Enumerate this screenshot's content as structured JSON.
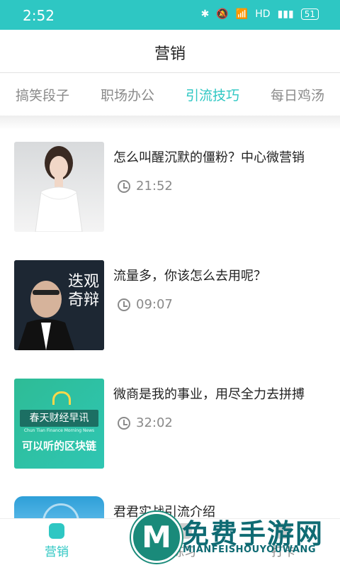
{
  "status": {
    "time": "2:52",
    "network": "HD",
    "battery": "51"
  },
  "header": {
    "title": "营销"
  },
  "tabs": [
    {
      "label": "搞笑段子"
    },
    {
      "label": "职场办公"
    },
    {
      "label": "引流技巧",
      "active": true
    },
    {
      "label": "每日鸡汤"
    }
  ],
  "items": [
    {
      "title": "怎么叫醒沉默的僵粉？中心微营销",
      "duration": "21:52"
    },
    {
      "title": "流量多，你该怎么去用呢？",
      "duration": "09:07",
      "thumb_text": "迭观奇辩"
    },
    {
      "title": "微商是我的事业，用尽全力去拼搏",
      "duration": "32:02",
      "thumb_text": {
        "line1": "春天财经早讯",
        "line2": "Chun Tian Finance Morning News",
        "line3": "可以听的区块链"
      }
    },
    {
      "title": "君君实战引流介绍"
    }
  ],
  "bottom_nav": [
    {
      "label": "营销",
      "active": true
    },
    {
      "label": "练习"
    },
    {
      "label": "打卡"
    }
  ],
  "watermark": {
    "text": "免费手游网",
    "sub": "MIANFEISHOUYOUWANG",
    "logo": "M"
  },
  "colors": {
    "accent": "#2ec7c3",
    "text": "#222222",
    "muted": "#8a8a8a"
  }
}
